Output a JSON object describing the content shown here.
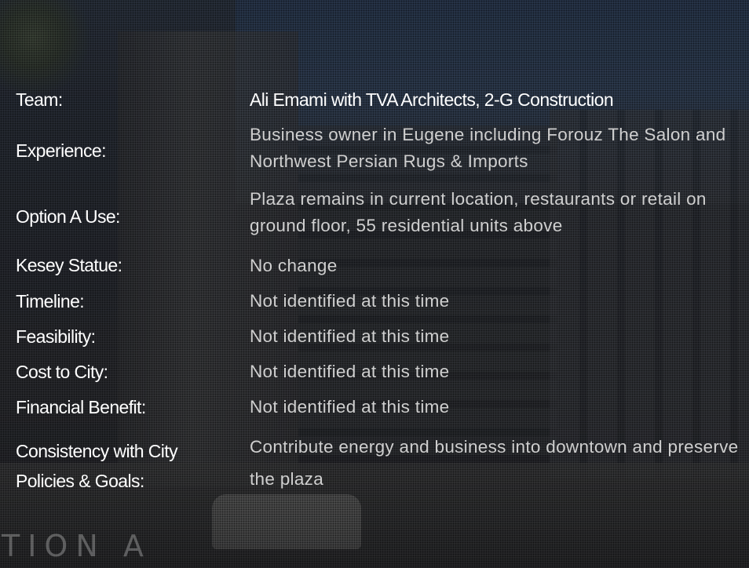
{
  "watermark": "TION A",
  "rows": [
    {
      "label": "Team:",
      "value": "Ali Emami with TVA Architects, 2-G Construction"
    },
    {
      "label": "Experience:",
      "value": "Business owner in Eugene including Forouz The Salon and Northwest Persian Rugs & Imports"
    },
    {
      "label": "Option A Use:",
      "value": "Plaza remains in current location, restaurants or retail on ground floor, 55 residential units above"
    },
    {
      "label": "Kesey Statue:",
      "value": "No change"
    },
    {
      "label": "Timeline:",
      "value": "Not identified at this time"
    },
    {
      "label": "Feasibility:",
      "value": "Not identified at this time"
    },
    {
      "label": "Cost to City:",
      "value": "Not identified at this time"
    },
    {
      "label": "Financial Benefit:",
      "value": "Not identified at this time"
    },
    {
      "label": "Consistency with City Policies & Goals:",
      "value": "Contribute energy  and business into downtown and preserve the plaza"
    }
  ],
  "colors": {
    "label_text": "#ffffff",
    "value_text": "#cfcfcf"
  }
}
